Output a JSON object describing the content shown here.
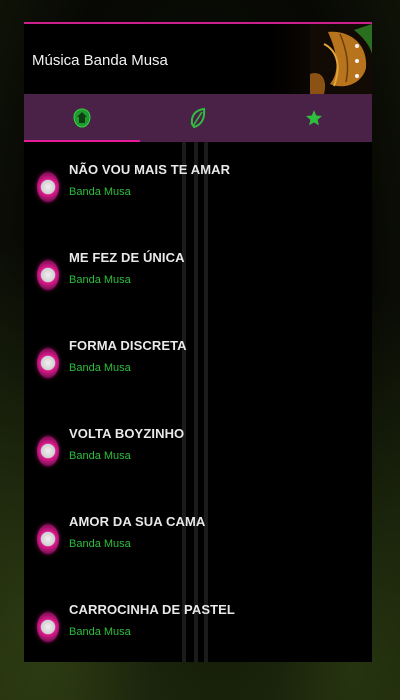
{
  "app": {
    "title": "Música Banda Musa"
  },
  "tabs": [
    {
      "icon": "home-icon"
    },
    {
      "icon": "leaf-icon"
    },
    {
      "icon": "star-icon"
    }
  ],
  "colors": {
    "accent": "#e61b95",
    "tabbar": "#4a2147",
    "icon_green": "#2fbf3f",
    "artist_green": "#2fbf3f"
  },
  "songs": [
    {
      "title": "NÃO VOU MAIS TE AMAR",
      "artist": "Banda Musa"
    },
    {
      "title": "ME FEZ DE ÚNICA",
      "artist": "Banda Musa"
    },
    {
      "title": "FORMA DISCRETA",
      "artist": "Banda Musa"
    },
    {
      "title": "VOLTA BOYZINHO",
      "artist": "Banda Musa"
    },
    {
      "title": "AMOR DA SUA CAMA",
      "artist": "Banda Musa"
    },
    {
      "title": "CARROCINHA DE PASTEL",
      "artist": "Banda Musa"
    }
  ]
}
